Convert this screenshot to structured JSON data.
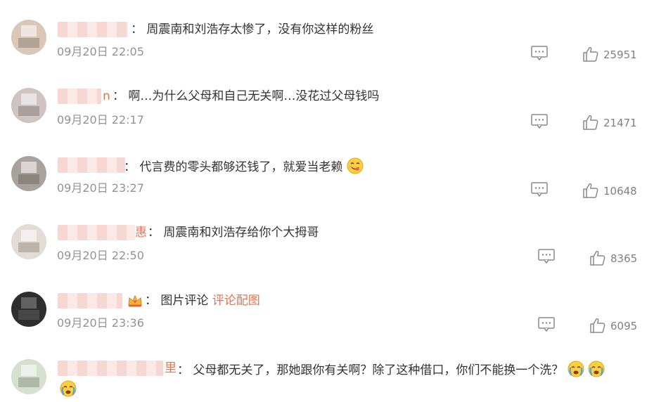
{
  "comments": [
    {
      "text": "： 周震南和刘浩存太惨了，没有你这样的粉丝",
      "time": "09月20日 22:05",
      "likes": "25951",
      "avatar_color": "#d9c7b8"
    },
    {
      "name_tail": "n",
      "text": "： 啊…为什么父母和自己无关啊…没花过父母钱吗",
      "time": "09月20日 22:17",
      "likes": "21471",
      "avatar_color": "#cfc4c0"
    },
    {
      "text": "： 代言费的零头都够还钱了，就爱当老赖",
      "emoji": "face-savoring-food-icon",
      "time": "09月20日 23:27",
      "likes": "10648",
      "avatar_color": "#a9a29c"
    },
    {
      "name_tail": "惠",
      "text": "： 周震南和刘浩存给你个大拇哥",
      "time": "09月20日 22:50",
      "likes": "8365",
      "avatar_color": "#e3dcd4"
    },
    {
      "badge": "crown-icon",
      "text_pre": "： 图片评论 ",
      "link": "评论配图",
      "time": "09月20日 23:36",
      "likes": "6095",
      "avatar_color": "#2e2e2e"
    },
    {
      "name_tail": "里",
      "text": "： 父母都无关了，那她跟你有关啊？除了这种借口，你们不能换一个洗？",
      "emoji": "crying-face-icon",
      "avatar_color": "#d5e0cf"
    }
  ],
  "colors": {
    "link": "#eb7350",
    "meta": "#939393",
    "text": "#333333"
  }
}
